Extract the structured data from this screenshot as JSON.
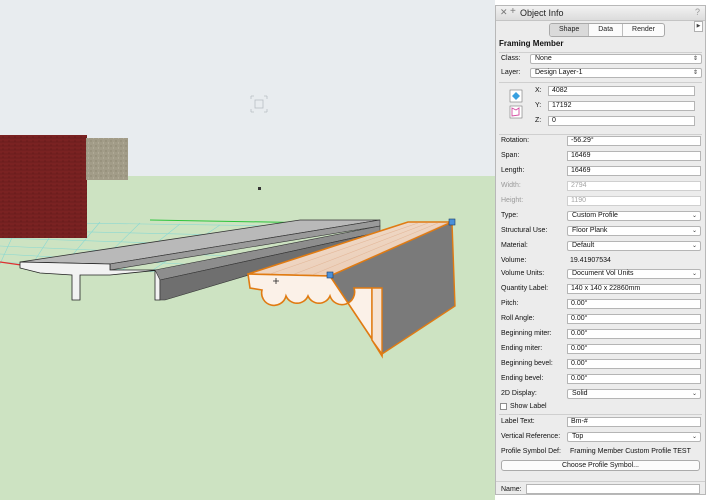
{
  "panel": {
    "title": "Object Info",
    "close_glyph": "✕",
    "add_glyph": "+",
    "help_glyph": "?",
    "tabs": [
      "Shape",
      "Data",
      "Render"
    ],
    "active_tab": "Shape",
    "object_type": "Framing Member"
  },
  "fields": {
    "class_label": "Class:",
    "class_value": "None",
    "layer_label": "Layer:",
    "layer_value": "Design Layer-1",
    "x_label": "X:",
    "x_value": "4082",
    "y_label": "Y:",
    "y_value": "17192",
    "z_label": "Z:",
    "z_value": "0",
    "rotation_label": "Rotation:",
    "rotation_value": "-56.29°",
    "span_label": "Span:",
    "span_value": "16469",
    "length_label": "Length:",
    "length_value": "16469",
    "width_label": "Width:",
    "width_value": "2794",
    "height_label": "Height:",
    "height_value": "1190",
    "type_label": "Type:",
    "type_value": "Custom Profile",
    "structural_use_label": "Structural Use:",
    "structural_use_value": "Floor Plank",
    "material_label": "Material:",
    "material_value": "Default",
    "volume_label": "Volume:",
    "volume_value": "19.41907534",
    "volume_units_label": "Volume Units:",
    "volume_units_value": "Document Vol Units",
    "quantity_label_label": "Quantity Label:",
    "quantity_label_value": "140 x 140 x 22860mm",
    "pitch_label": "Pitch:",
    "pitch_value": "0.00°",
    "roll_angle_label": "Roll Angle:",
    "roll_angle_value": "0.00°",
    "beginning_miter_label": "Beginning miter:",
    "beginning_miter_value": "0.00°",
    "ending_miter_label": "Ending miter:",
    "ending_miter_value": "0.00°",
    "beginning_bevel_label": "Beginning bevel:",
    "beginning_bevel_value": "0.00°",
    "ending_bevel_label": "Ending bevel:",
    "ending_bevel_value": "0.00°",
    "display_2d_label": "2D Display:",
    "display_2d_value": "Solid",
    "show_label_label": "Show Label",
    "label_text_label": "Label Text:",
    "label_text_value": "Bm-#",
    "vertical_reference_label": "Vertical Reference:",
    "vertical_reference_value": "Top",
    "profile_symbol_def_label": "Profile Symbol Def:",
    "profile_symbol_def_value": "Framing Member Custom Profile TEST",
    "choose_profile_button": "Choose Profile Symbol...",
    "name_label": "Name:",
    "name_value": ""
  },
  "icons": {
    "chevron": "⌃⌄",
    "dropdown": "⌄"
  },
  "colors": {
    "sky": "#e8ecef",
    "ground": "#cde3c2",
    "selection": "#e07b12",
    "handle": "#4a90d9"
  }
}
